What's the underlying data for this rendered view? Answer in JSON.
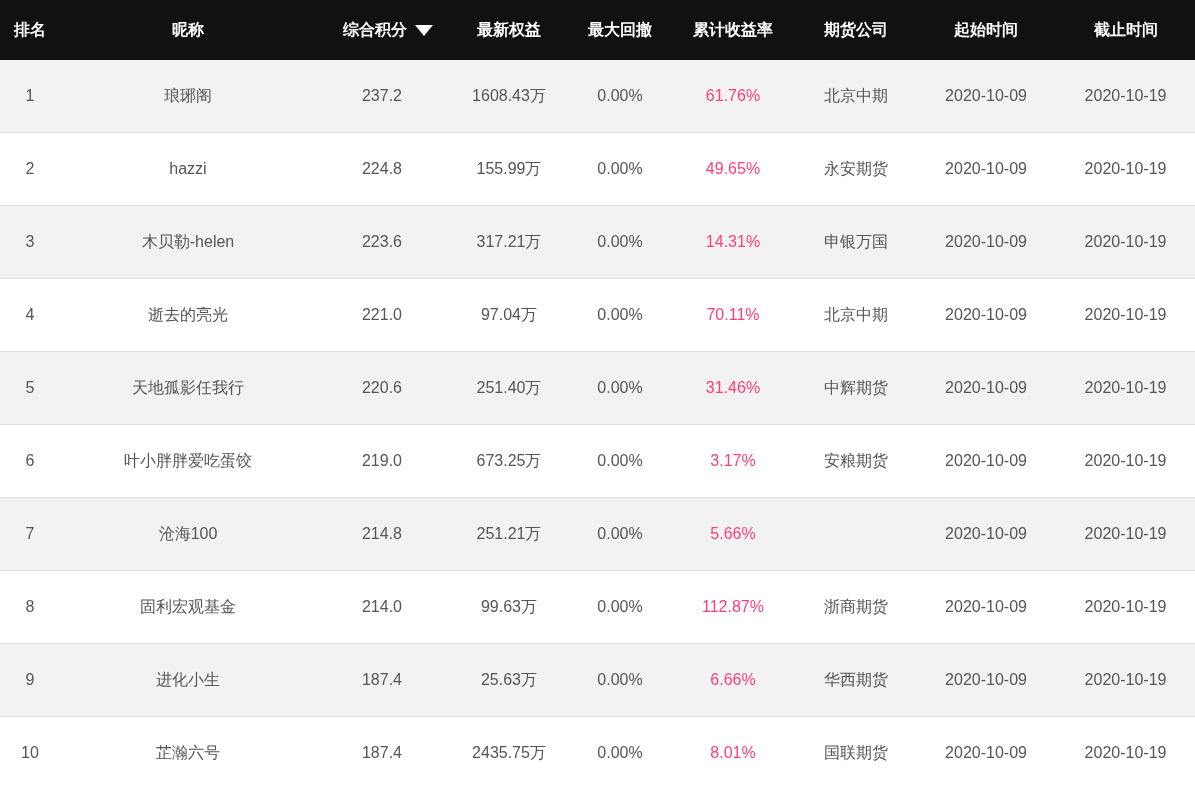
{
  "table": {
    "columns": [
      {
        "label": "排名",
        "sorted": false
      },
      {
        "label": "昵称",
        "sorted": false
      },
      {
        "label": "综合积分",
        "sorted": true
      },
      {
        "label": "最新权益",
        "sorted": false
      },
      {
        "label": "最大回撤",
        "sorted": false
      },
      {
        "label": "累计收益率",
        "sorted": false
      },
      {
        "label": "期货公司",
        "sorted": false
      },
      {
        "label": "起始时间",
        "sorted": false
      },
      {
        "label": "截止时间",
        "sorted": false
      }
    ],
    "rows": [
      {
        "rank": "1",
        "nickname": "琅琊阁",
        "score": "237.2",
        "equity": "1608.43万",
        "drawdown": "0.00%",
        "return": "61.76%",
        "company": "北京中期",
        "start": "2020-10-09",
        "end": "2020-10-19"
      },
      {
        "rank": "2",
        "nickname": "hazzi",
        "score": "224.8",
        "equity": "155.99万",
        "drawdown": "0.00%",
        "return": "49.65%",
        "company": "永安期货",
        "start": "2020-10-09",
        "end": "2020-10-19"
      },
      {
        "rank": "3",
        "nickname": "木贝勒-helen",
        "score": "223.6",
        "equity": "317.21万",
        "drawdown": "0.00%",
        "return": "14.31%",
        "company": "申银万国",
        "start": "2020-10-09",
        "end": "2020-10-19"
      },
      {
        "rank": "4",
        "nickname": "逝去的亮光",
        "score": "221.0",
        "equity": "97.04万",
        "drawdown": "0.00%",
        "return": "70.11%",
        "company": "北京中期",
        "start": "2020-10-09",
        "end": "2020-10-19"
      },
      {
        "rank": "5",
        "nickname": "天地孤影任我行",
        "score": "220.6",
        "equity": "251.40万",
        "drawdown": "0.00%",
        "return": "31.46%",
        "company": "中辉期货",
        "start": "2020-10-09",
        "end": "2020-10-19"
      },
      {
        "rank": "6",
        "nickname": "叶小胖胖爱吃蛋饺",
        "score": "219.0",
        "equity": "673.25万",
        "drawdown": "0.00%",
        "return": "3.17%",
        "company": "安粮期货",
        "start": "2020-10-09",
        "end": "2020-10-19"
      },
      {
        "rank": "7",
        "nickname": "沧海100",
        "score": "214.8",
        "equity": "251.21万",
        "drawdown": "0.00%",
        "return": "5.66%",
        "start": "2020-10-09",
        "end": "2020-10-19"
      },
      {
        "rank": "8",
        "nickname": "固利宏观基金",
        "score": "214.0",
        "equity": "99.63万",
        "drawdown": "0.00%",
        "return": "112.87%",
        "company": "浙商期货",
        "start": "2020-10-09",
        "end": "2020-10-19"
      },
      {
        "rank": "9",
        "nickname": "进化小生",
        "score": "187.4",
        "equity": "25.63万",
        "drawdown": "0.00%",
        "return": "6.66%",
        "company": "华西期货",
        "start": "2020-10-09",
        "end": "2020-10-19"
      },
      {
        "rank": "10",
        "nickname": "芷瀚六号",
        "score": "187.4",
        "equity": "2435.75万",
        "drawdown": "0.00%",
        "return": "8.01%",
        "company": "国联期货",
        "start": "2020-10-09",
        "end": "2020-10-19"
      }
    ]
  }
}
